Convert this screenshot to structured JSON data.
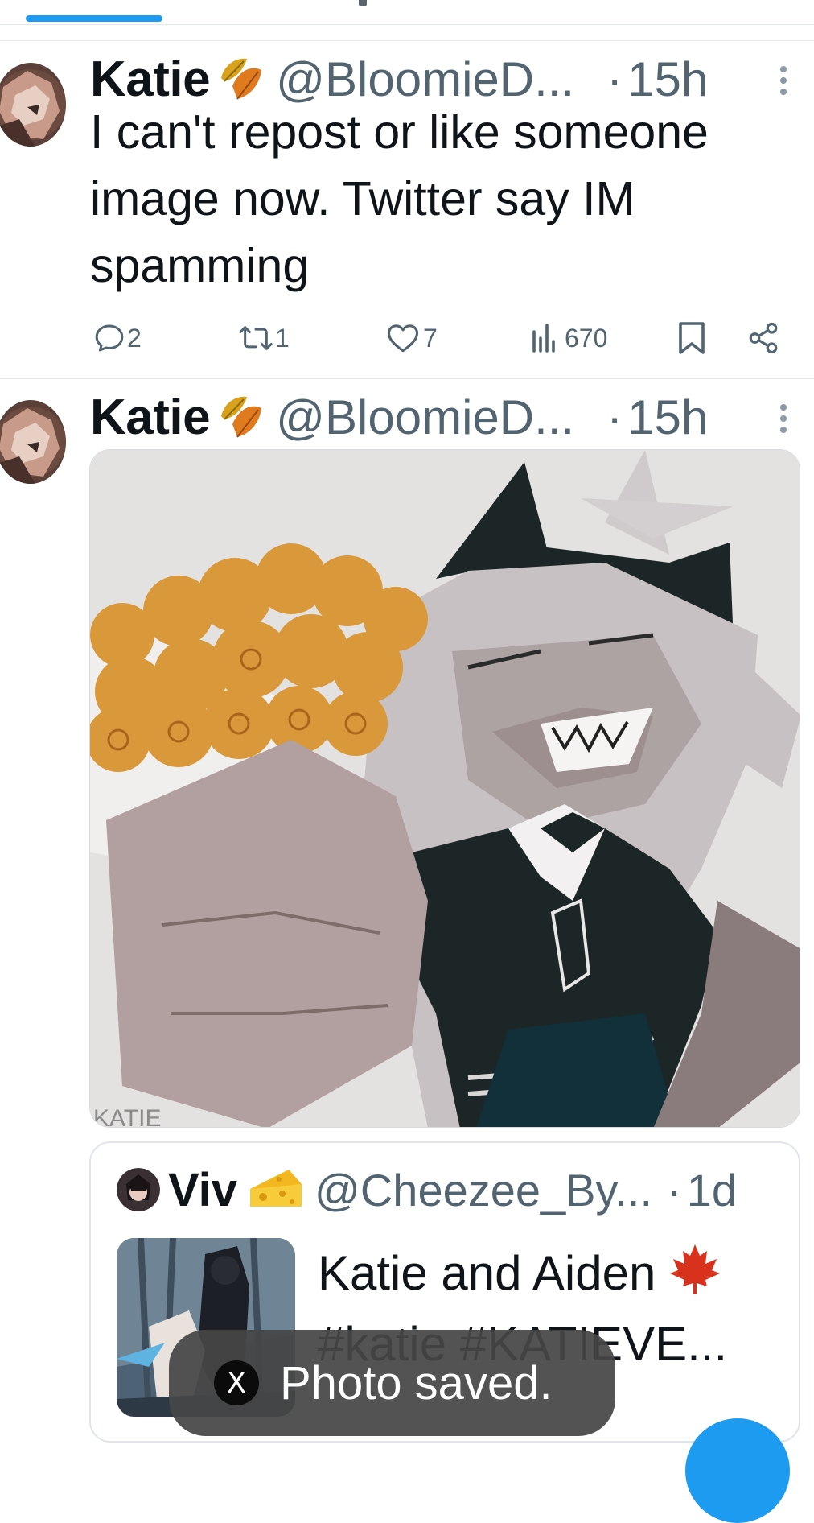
{
  "tweets": [
    {
      "name": "Katie",
      "handle": "@BloomieD...",
      "separator": "·",
      "time": "15h",
      "text": "I can't repost or like someone image now. Twitter say IM spamming",
      "replies": "2",
      "reposts": "1",
      "likes": "7",
      "views": "670"
    },
    {
      "name": "Katie",
      "handle": "@BloomieD...",
      "separator": "·",
      "time": "15h",
      "media_signature": "KATIE"
    }
  ],
  "quote": {
    "name": "Viv",
    "handle": "@Cheezee_By...",
    "separator": "·",
    "time": "1d",
    "text_line1": "Katie and Aiden",
    "text_line2": "#katie #KATIEVE..."
  },
  "toast": {
    "logo": "X",
    "text": "Photo saved."
  },
  "icons": {
    "reply": "reply-icon",
    "repost": "repost-icon",
    "like": "heart-icon",
    "views": "views-icon",
    "bookmark": "bookmark-icon",
    "share": "share-icon",
    "more": "more-icon"
  },
  "colors": {
    "accent": "#1d9bf0",
    "text": "#0f1419",
    "secondary": "#536471",
    "toast_bg": "#464646"
  }
}
